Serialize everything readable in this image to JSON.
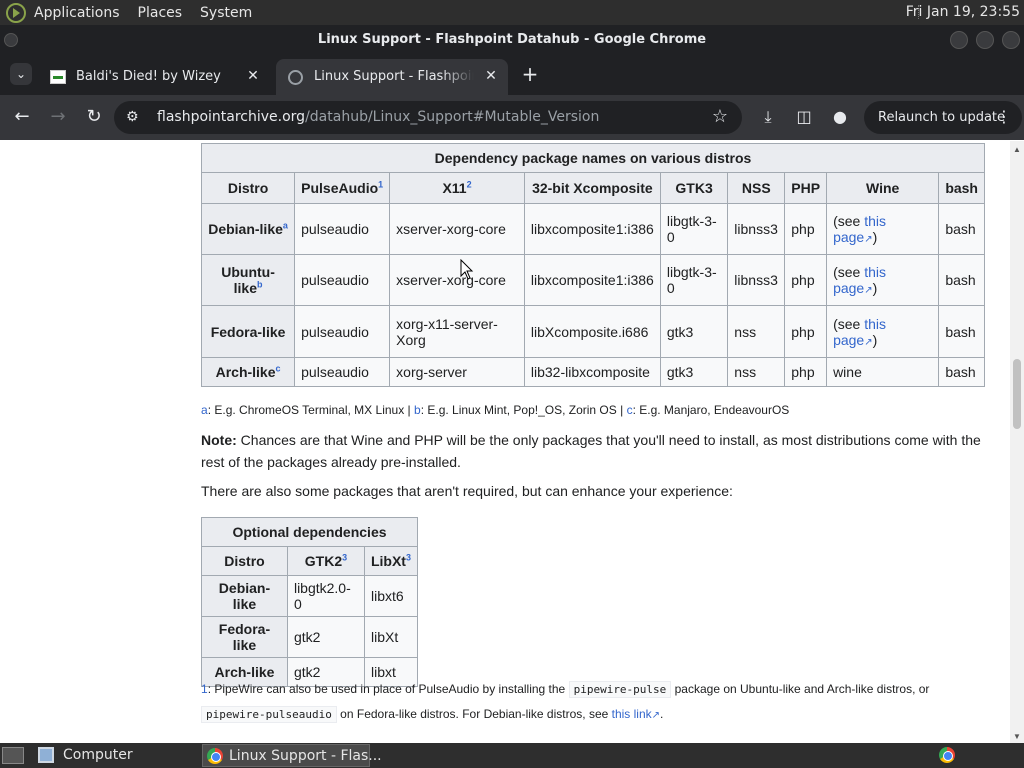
{
  "panel": {
    "menus": [
      "Applications",
      "Places",
      "System"
    ],
    "clock": "Fri Jan 19, 23:55"
  },
  "window": {
    "title": "Linux Support - Flashpoint Datahub - Google Chrome"
  },
  "tabs": [
    {
      "label": "Baldi's Died! by Wizey",
      "active": false
    },
    {
      "label": "Linux Support - Flashpoint Datahub",
      "active": true
    }
  ],
  "toolbar": {
    "url_host": "flashpointarchive.org",
    "url_path": "/datahub/Linux_Support#Mutable_Version",
    "relaunch_label": "Relaunch to update"
  },
  "deps_table": {
    "caption": "Dependency package names on various distros",
    "headers": [
      "Distro",
      "PulseAudio",
      "X11",
      "32-bit Xcomposite",
      "GTK3",
      "NSS",
      "PHP",
      "Wine",
      "bash"
    ],
    "header_sups": [
      "",
      "1",
      "2",
      "",
      "",
      "",
      "",
      "",
      ""
    ],
    "rows": [
      {
        "distro": "Debian-like",
        "sup": "a",
        "pulse": "pulseaudio",
        "x11": "xserver-xorg-core",
        "xcomp": "libxcomposite1:i386",
        "gtk3": "libgtk-3-0",
        "nss": "libnss3",
        "php": "php",
        "bash": "bash"
      },
      {
        "distro": "Ubuntu-like",
        "sup": "b",
        "pulse": "pulseaudio",
        "x11": "xserver-xorg-core",
        "xcomp": "libxcomposite1:i386",
        "gtk3": "libgtk-3-0",
        "nss": "libnss3",
        "php": "php",
        "bash": "bash"
      },
      {
        "distro": "Fedora-like",
        "sup": "",
        "pulse": "pulseaudio",
        "x11": "xorg-x11-server-Xorg",
        "xcomp": "libXcomposite.i686",
        "gtk3": "gtk3",
        "nss": "nss",
        "php": "php",
        "bash": "bash"
      },
      {
        "distro": "Arch-like",
        "sup": "c",
        "pulse": "pulseaudio",
        "x11": "xorg-server",
        "xcomp": "lib32-libxcomposite",
        "gtk3": "gtk3",
        "nss": "nss",
        "php": "php",
        "wine": "wine",
        "bash": "bash"
      }
    ],
    "wine_see_open": "(see ",
    "wine_see_link": "this page",
    "wine_see_close": ")"
  },
  "notes": {
    "a_key": "a",
    "a_text": ": E.g. ChromeOS Terminal, MX Linux | ",
    "b_key": "b",
    "b_text": ": E.g. Linux Mint, Pop!_OS, Zorin OS | ",
    "c_key": "c",
    "c_text": ": E.g. Manjaro, EndeavourOS"
  },
  "para_note": {
    "label": "Note:",
    "text": " Chances are that Wine and PHP will be the only packages that you'll need to install, as most distributions come with the rest of the packages already pre-installed."
  },
  "para_optional": "There are also some packages that aren't required, but can enhance your experience:",
  "opt_table": {
    "caption": "Optional dependencies",
    "headers": [
      "Distro",
      "GTK2",
      "LibXt"
    ],
    "header_sups": [
      "",
      "3",
      "3"
    ],
    "rows": [
      {
        "distro": "Debian-like",
        "gtk2": "libgtk2.0-0",
        "libxt": "libxt6"
      },
      {
        "distro": "Fedora-like",
        "gtk2": "gtk2",
        "libxt": "libXt"
      },
      {
        "distro": "Arch-like",
        "gtk2": "gtk2",
        "libxt": "libxt"
      }
    ]
  },
  "footnote1": {
    "key": "1",
    "text_a": ": PipeWire can also be used in place of PulseAudio by installing the ",
    "code_a": "pipewire-pulse",
    "text_b": " package on Ubuntu-like and Arch-like distros, or",
    "code_b": "pipewire-pulseaudio",
    "text_c": " on Fedora-like distros. For Debian-like distros, see ",
    "link": "this link",
    "text_d": "."
  },
  "taskbar": {
    "items": [
      "Computer",
      "Linux Support - Flas..."
    ]
  }
}
